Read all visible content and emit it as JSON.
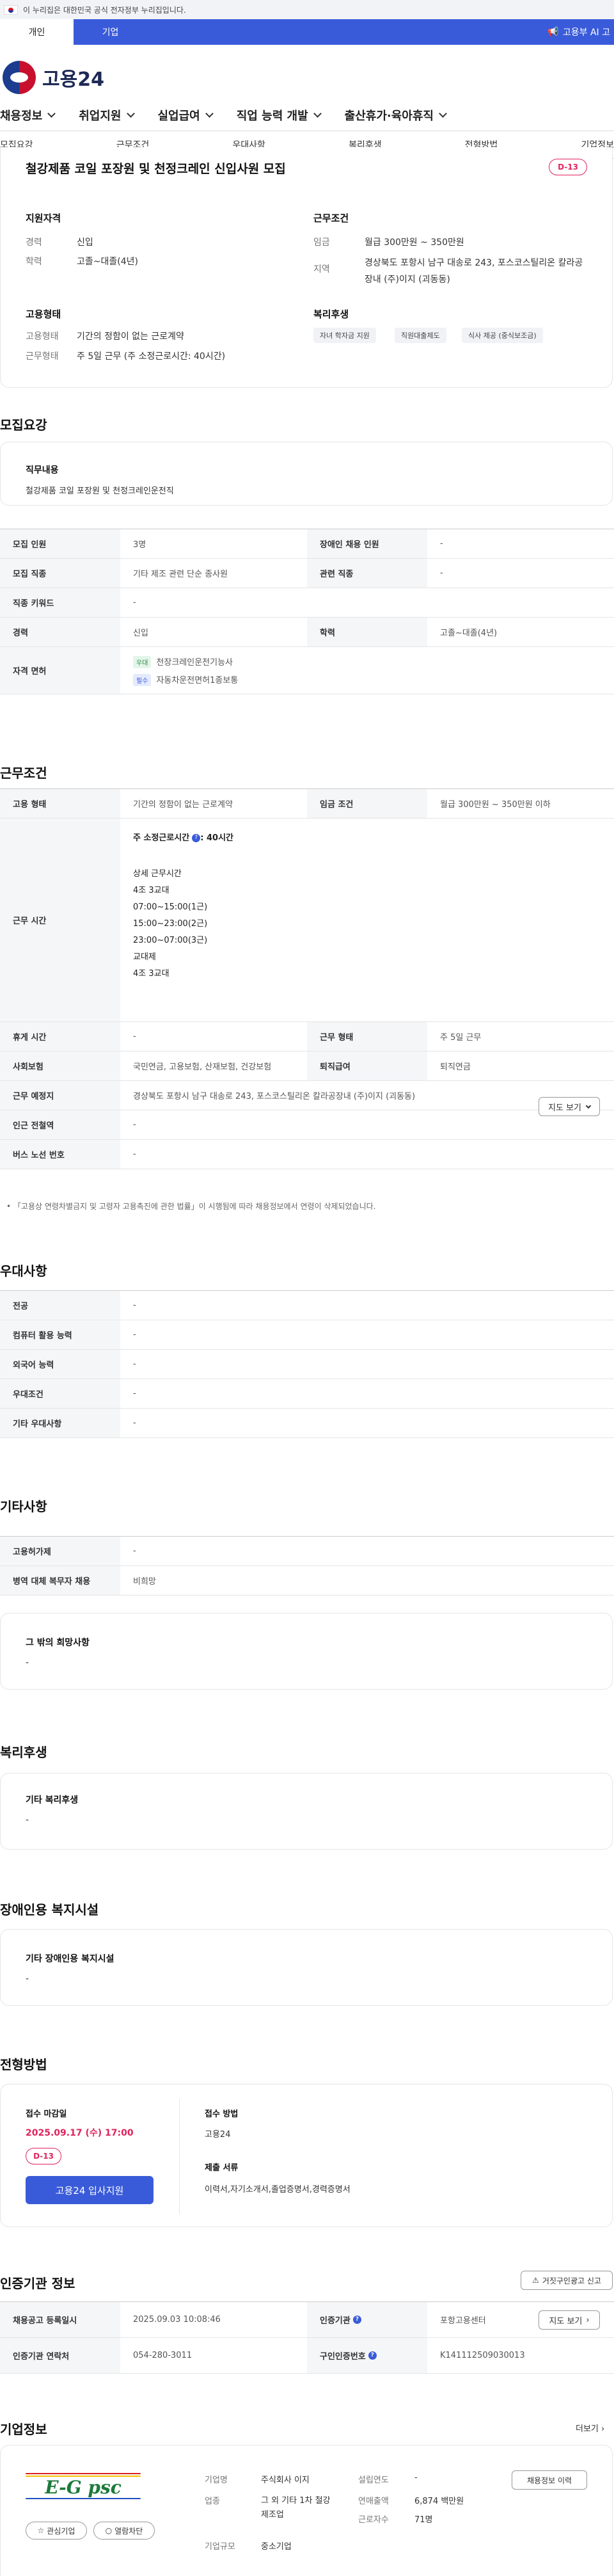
{
  "gov_banner": "이 누리집은 대한민국 공식 전자정부 누리집입니다.",
  "top_tabs": [
    "개인",
    "기업"
  ],
  "ai_banner": "고용부 AI 고",
  "logo_text": "고용24",
  "main_nav": [
    "채용정보",
    "취업지원",
    "실업급여",
    "직업 능력 개발",
    "출산휴가·육아휴직"
  ],
  "sub_nav": [
    "모집요강",
    "근무조건",
    "우대사항",
    "복리후생",
    "전형방법",
    "기업정보"
  ],
  "job": {
    "title": "철강제품 코일 포장원 및 천정크레인 신입사원 모집",
    "dday": "D-13",
    "qual_head": "지원자격",
    "career_label": "경력",
    "career": "신입",
    "edu_label": "학력",
    "edu": "고졸~대졸(4년)",
    "emp_head": "고용형태",
    "emptype_label": "고용형태",
    "emptype": "기간의 정함이 없는 근로계약",
    "worktype_label": "근무형태",
    "worktype": "주 5일 근무 (주 소정근로시간: 40시간)",
    "cond_head": "근무조건",
    "wage_label": "임금",
    "wage": "월급 300만원 ~ 350만원",
    "region_label": "지역",
    "region": "경상북도 포항시 남구 대송로 243, 포스코스틸리온 칼라공장내 (주)이지 (괴동동)",
    "welfare_head": "복리후생",
    "welfare_chips": [
      "자녀 학자금 지원",
      "직원대출제도",
      "식사 제공 (중식보조금)"
    ]
  },
  "recruit": {
    "section": "모집요강",
    "duty_head": "직무내용",
    "duty": "철강제품 코일 포장원 및 천정크레인운전직",
    "rows": {
      "count_label": "모집 인원",
      "count": "3명",
      "disabled_label": "장애인 채용 인원",
      "disabled": "-",
      "field_label": "모집 직종",
      "field": "기타 제조 관련 단순 종사원",
      "related_label": "관련 직종",
      "related": "-",
      "keyword_label": "직종 키워드",
      "keyword": "-",
      "career_label": "경력",
      "career": "신입",
      "edu_label": "학력",
      "edu": "고졸~대졸(4년)",
      "license_label": "자격 면허",
      "lic1_tag": "우대",
      "lic1": "천장크레인운전기능사",
      "lic2_tag": "필수",
      "lic2": "자동차운전면허1종보통"
    }
  },
  "work": {
    "section": "근무조건",
    "emptype_label": "고용 형태",
    "emptype": "기간의 정함이 없는 근로계약",
    "wage_label": "임금 조건",
    "wage": "월급 300만원 ~ 350만원 이하",
    "hours_label": "근무 시간",
    "hours_main_pre": "주 소정근로시간",
    "hours_main_post": ": 40시간",
    "hours_detail": [
      "상세 근무시간",
      "4조 3교대",
      "07:00~15:00(1근)",
      "15:00~23:00(2근)",
      "23:00~07:00(3근)",
      "교대제",
      "4조 3교대"
    ],
    "break_label": "휴게 시간",
    "break": "-",
    "form_label": "근무 형태",
    "form": "주 5일 근무",
    "insurance_label": "사회보험",
    "insurance": "국민연금, 고용보험, 산재보험, 건강보험",
    "retire_label": "퇴직급여",
    "retire": "퇴직연금",
    "place_label": "근무 예정지",
    "place": "경상북도 포항시 남구 대송로 243, 포스코스틸리온 칼라공장내 (주)이지 (괴동동)",
    "map_btn": "지도 보기",
    "subway_label": "인근 전철역",
    "subway": "-",
    "bus_label": "버스 노선 번호",
    "bus": "-",
    "note": "「고용상 연령차별금지 및 고령자 고용촉진에 관한 법률」이 시행됨에 따라 채용정보에서 연령이 삭제되었습니다."
  },
  "pref": {
    "section": "우대사항",
    "rows": [
      [
        "전공",
        "-"
      ],
      [
        "컴퓨터 활용 능력",
        "-"
      ],
      [
        "외국어 능력",
        "-"
      ],
      [
        "우대조건",
        "-"
      ],
      [
        "기타 우대사항",
        "-"
      ]
    ]
  },
  "etc": {
    "section": "기타사항",
    "rows": [
      [
        "고용허가제",
        "-"
      ],
      [
        "병역 대체 복무자 채용",
        "비희망"
      ]
    ],
    "other_head": "그 밖의 희망사항",
    "other": "-"
  },
  "welfare": {
    "section": "복리후생",
    "head": "기타 복리후생",
    "val": "-"
  },
  "disab": {
    "section": "장애인용 복지시설",
    "head": "기타 장애인용 복지시설",
    "val": "-"
  },
  "screen": {
    "section": "전형방법",
    "deadline_head": "접수 마감일",
    "deadline": "2025.09.17 (수) 17:00",
    "dday": "D-13",
    "apply_btn": "고용24 입사지원",
    "method_head": "접수 방법",
    "method": "고용24",
    "docs_head": "제출 서류",
    "docs": "이력서,자기소개서,졸업증명서,경력증명서"
  },
  "cert": {
    "section": "인증기관 정보",
    "report_btn": "거짓구인광고 신고",
    "reg_label": "채용공고 등록일시",
    "reg": "2025.09.03 10:08:46",
    "org_label": "인증기관",
    "org": "포항고용센터",
    "map_btn": "지도 보기",
    "contact_label": "인증기관 연락처",
    "contact": "054-280-3011",
    "auth_label": "구인인증번호",
    "auth": "K141112509030013"
  },
  "company": {
    "section": "기업정보",
    "more": "더보기",
    "logo_text": "E-G psc",
    "fav_btn": "관심기업",
    "block_btn": "열람차단",
    "name_label": "기업명",
    "name": "주식회사 이지",
    "year_label": "설립연도",
    "year": "-",
    "status_btn": "채용정보 이력",
    "industry_label": "업종",
    "industry": "그 외 기타 1차 철강 제조업",
    "sales_label": "연매출액",
    "sales": "6,874 백만원",
    "staff_label": "근로자수",
    "staff": "71명",
    "size_label": "기업규모",
    "size": "중소기업"
  },
  "colors": {
    "primary": "#3a5bd9",
    "accent": "#e0245e"
  }
}
